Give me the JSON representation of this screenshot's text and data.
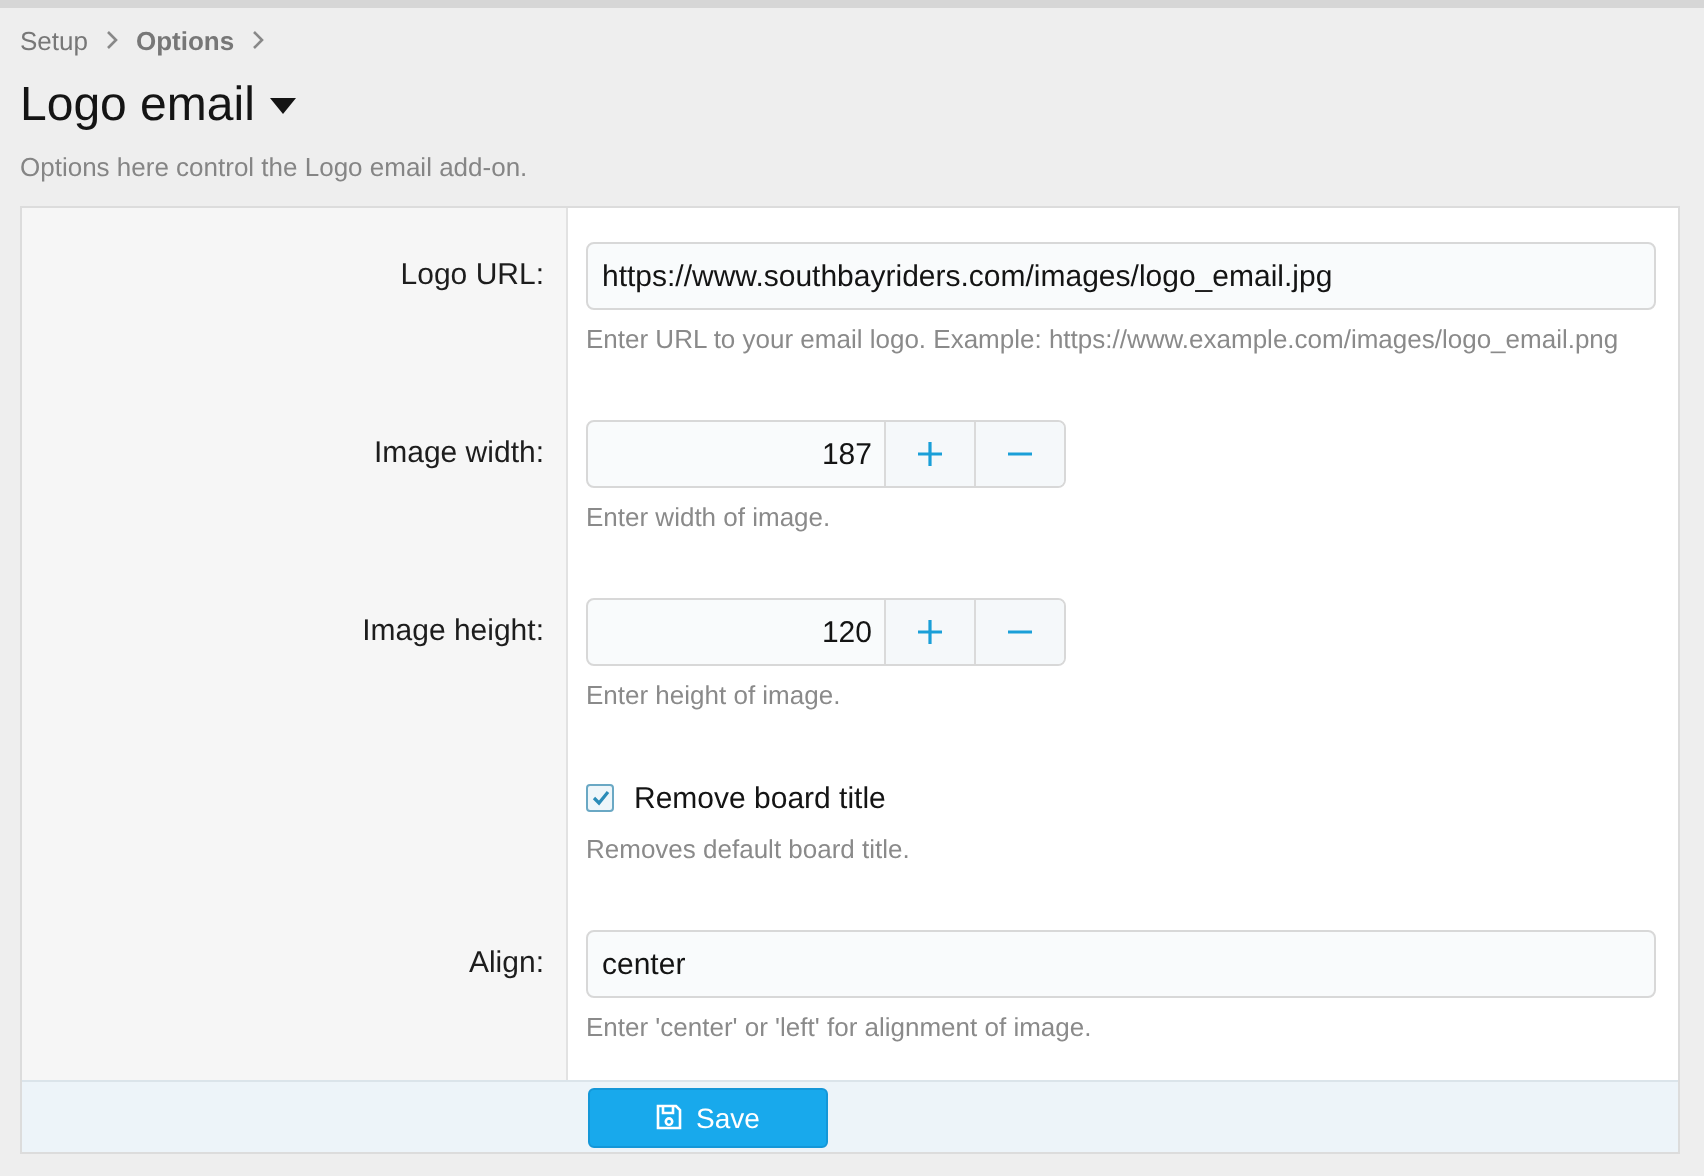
{
  "breadcrumb": [
    {
      "label": "Setup",
      "current": false
    },
    {
      "label": "Options",
      "current": true
    }
  ],
  "title": "Logo email",
  "description": "Options here control the Logo email add-on.",
  "options": [
    {
      "kind": "text",
      "label": "Logo URL:",
      "value": "https://www.southbayriders.com/images/logo_email.jpg",
      "hint": "Enter URL to your email logo. Example: https://www.example.com/images/logo_email.png"
    },
    {
      "kind": "number",
      "label": "Image width:",
      "value": "187",
      "hint": "Enter width of image."
    },
    {
      "kind": "number",
      "label": "Image height:",
      "value": "120",
      "hint": "Enter height of image."
    },
    {
      "kind": "checkbox",
      "text": "Remove board title",
      "checked": true,
      "hint": "Removes default board title."
    },
    {
      "kind": "text",
      "label": "Align:",
      "value": "center",
      "hint": "Enter 'center' or 'left' for alignment of image."
    }
  ],
  "save_button": "Save"
}
